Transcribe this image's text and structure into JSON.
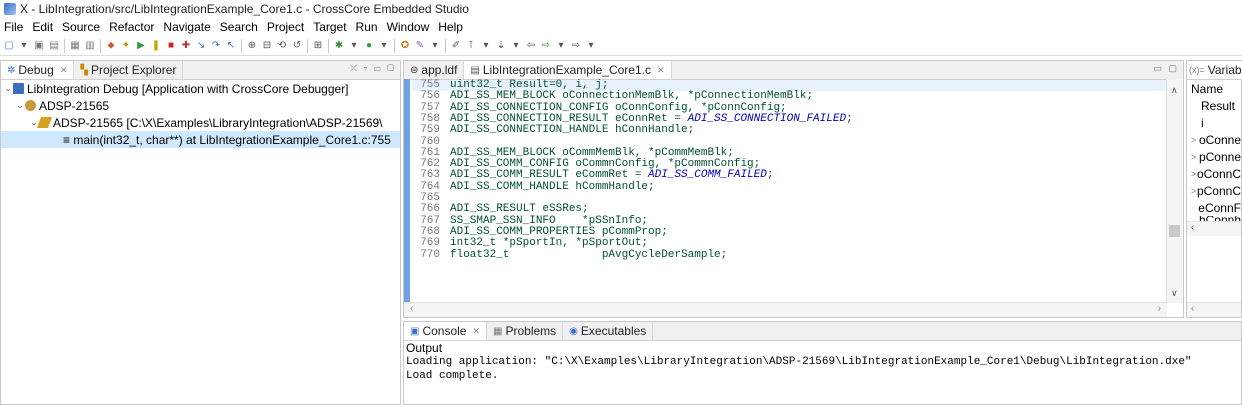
{
  "window": {
    "title": "X - LibIntegration/src/LibIntegrationExample_Core1.c - CrossCore Embedded Studio"
  },
  "menu": [
    "File",
    "Edit",
    "Source",
    "Refactor",
    "Navigate",
    "Search",
    "Project",
    "Target",
    "Run",
    "Window",
    "Help"
  ],
  "left_panel": {
    "tabs": [
      {
        "label": "Debug",
        "close": "✕"
      },
      {
        "label": "Project Explorer"
      }
    ],
    "tree": [
      {
        "label": "LibIntegration Debug [Application with CrossCore Debugger]"
      },
      {
        "label": "ADSP-21565"
      },
      {
        "label": "ADSP-21565 [C:\\X\\Examples\\LibraryIntegration\\ADSP-21569\\"
      },
      {
        "label": "≡ main(int32_t, char**) at LibIntegrationExample_Core1.c:755"
      }
    ]
  },
  "editor": {
    "tabs": [
      {
        "label": "app.ldf"
      },
      {
        "label": "LibIntegrationExample_Core1.c",
        "close": "✕"
      }
    ],
    "lines": [
      {
        "num": "755",
        "text": "uint32_t Result=0, i, j;"
      },
      {
        "num": "756",
        "text": "ADI_SS_MEM_BLOCK oConnectionMemBlk, *pConnectionMemBlk;"
      },
      {
        "num": "757",
        "text": "ADI_SS_CONNECTION_CONFIG oConnConfig, *pConnConfig;"
      },
      {
        "num": "758",
        "pre": "ADI_SS_CONNECTION_RESULT eConnRet = ",
        "const": "ADI_SS_CONNECTION_FAILED",
        "post": ";"
      },
      {
        "num": "759",
        "text": "ADI_SS_CONNECTION_HANDLE hConnHandle;"
      },
      {
        "num": "760",
        "text": ""
      },
      {
        "num": "761",
        "text": "ADI_SS_MEM_BLOCK oCommMemBlk, *pCommMemBlk;"
      },
      {
        "num": "762",
        "text": "ADI_SS_COMM_CONFIG oCommnConfig, *pCommnConfig;"
      },
      {
        "num": "763",
        "pre": "ADI_SS_COMM_RESULT eCommRet = ",
        "const": "ADI_SS_COMM_FAILED",
        "post": ";"
      },
      {
        "num": "764",
        "text": "ADI_SS_COMM_HANDLE hCommHandle;"
      },
      {
        "num": "765",
        "text": ""
      },
      {
        "num": "766",
        "text": "ADI_SS_RESULT eSSRes;"
      },
      {
        "num": "767",
        "text": "SS_SMAP_SSN_INFO    *pSSnInfo;"
      },
      {
        "num": "768",
        "text": "ADI_SS_COMM_PROPERTIES pCommProp;"
      },
      {
        "num": "769",
        "text": "int32_t *pSportIn, *pSportOut;"
      },
      {
        "num": "770",
        "text": "float32_t              pAvgCycleDerSample;"
      }
    ]
  },
  "variables": {
    "tab_label": "Variable",
    "header": "Name",
    "rows": [
      {
        "chev": "",
        "label": "Result"
      },
      {
        "chev": "",
        "label": "i"
      },
      {
        "chev": ">",
        "label": "oConne"
      },
      {
        "chev": ">",
        "label": "pConne"
      },
      {
        "chev": ">",
        "label": "oConnC"
      },
      {
        "chev": ">",
        "label": "pConnC"
      },
      {
        "chev": "",
        "label": "eConnF"
      },
      {
        "chev": "",
        "label": "hConnh"
      }
    ]
  },
  "console": {
    "tabs": [
      {
        "label": "Console",
        "close": "✕"
      },
      {
        "label": "Problems"
      },
      {
        "label": "Executables"
      }
    ],
    "header": "Output",
    "lines": [
      "Loading application: \"C:\\X\\Examples\\LibraryIntegration\\ADSP-21569\\LibIntegrationExample_Core1\\Debug\\LibIntegration.dxe\"",
      "Load complete."
    ]
  },
  "colors": {
    "accent": "#3d7fd8",
    "selection": "#cde8ff",
    "current_line": "#e8f2fe"
  }
}
